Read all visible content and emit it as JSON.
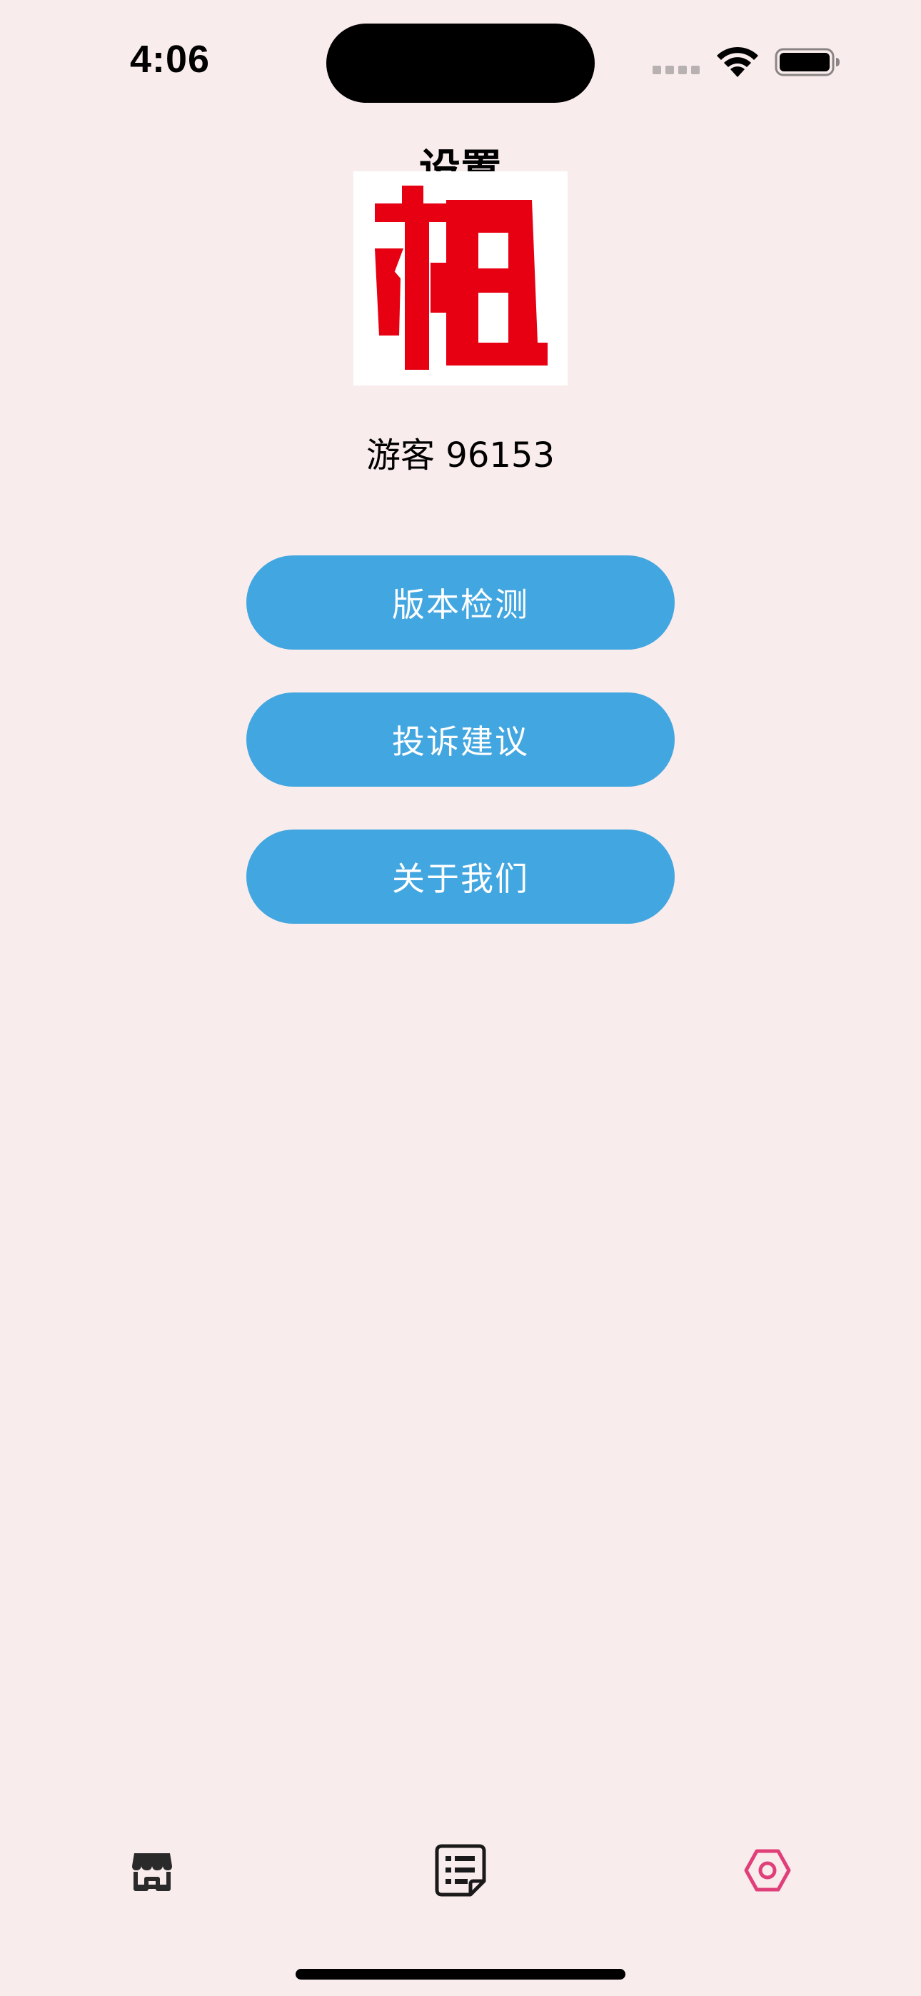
{
  "status_bar": {
    "time": "4:06"
  },
  "page": {
    "title": "设置"
  },
  "logo": {
    "icon": "logo-zu-character",
    "color": "#e60012"
  },
  "user": {
    "name": "游客 96153"
  },
  "menu": {
    "version_check": "版本检测",
    "feedback": "投诉建议",
    "about_us": "关于我们"
  },
  "tab_bar": {
    "items": [
      {
        "icon": "shop-icon",
        "active": false
      },
      {
        "icon": "list-icon",
        "active": false
      },
      {
        "icon": "settings-icon",
        "active": true
      }
    ],
    "active_color": "#e0407a",
    "inactive_color": "#2a2a2a"
  },
  "colors": {
    "background": "#f9ecec",
    "button": "#42a6e0",
    "button_text": "#ffffff"
  }
}
